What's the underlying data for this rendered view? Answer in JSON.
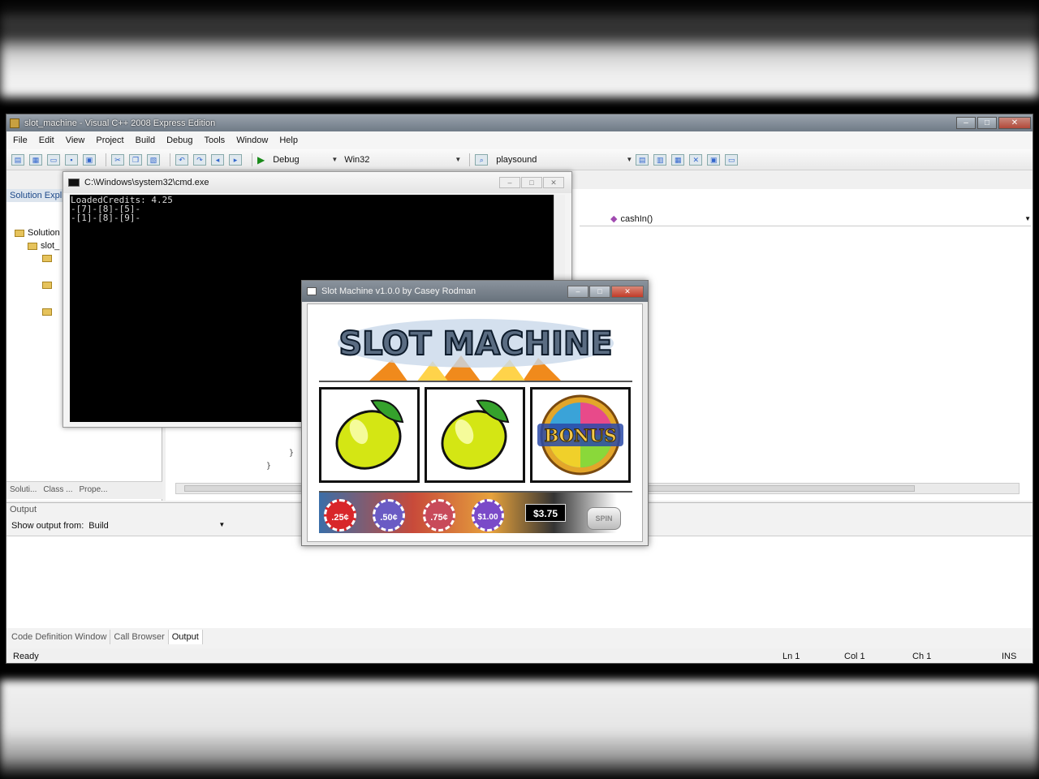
{
  "ide": {
    "title": "slot_machine - Visual C++ 2008 Express Edition",
    "menu": [
      "File",
      "Edit",
      "View",
      "Project",
      "Build",
      "Debug",
      "Tools",
      "Window",
      "Help"
    ],
    "toolbar": {
      "config": "Debug",
      "platform": "Win32",
      "search": "playsound"
    },
    "solution_panel": {
      "header": "Solution Expl",
      "items": [
        "Solution",
        "slot_"
      ],
      "tabs": [
        "Soluti...",
        "Class ...",
        "Prope..."
      ]
    },
    "editor": {
      "member_combo": "cashIn()"
    },
    "output": {
      "label": "Output",
      "show_from_label": "Show output from:",
      "show_from_value": "Build",
      "tabs": [
        "Code Definition Window",
        "Call Browser",
        "Output"
      ]
    },
    "status": {
      "ready": "Ready",
      "ln": "Ln 1",
      "col": "Col 1",
      "ch": "Ch 1",
      "ins": "INS"
    }
  },
  "cmd": {
    "title": "C:\\Windows\\system32\\cmd.exe",
    "lines": [
      "LoadedCredits: 4.25",
      "-[7]-[8]-[5]-",
      "-[1]-[8]-[9]-"
    ]
  },
  "slot": {
    "title": "Slot Machine v1.0.0 by Casey Rodman",
    "logo_text": "SLOT MACHINE",
    "reels": [
      "lemon",
      "lemon",
      "bonus"
    ],
    "bonus_text": "BONUS",
    "chips": [
      {
        "label": ".25¢",
        "color": "#d8262a"
      },
      {
        "label": ".50¢",
        "color": "#6a5bc4"
      },
      {
        "label": ".75¢",
        "color": "#c84a5a"
      },
      {
        "label": "$1.00",
        "color": "#7a4ac8"
      }
    ],
    "balance": "$3.75",
    "spin_label": "SPIN"
  }
}
